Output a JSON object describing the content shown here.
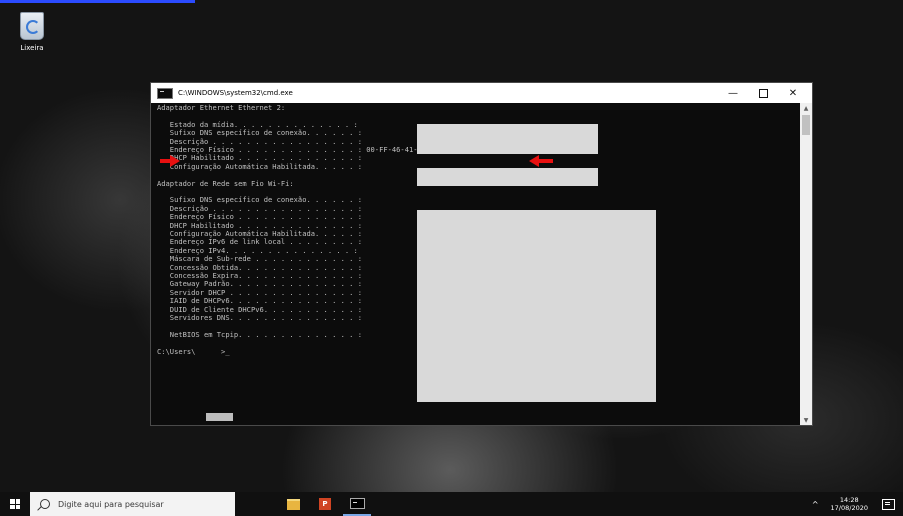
{
  "desktop": {
    "recycle_bin_label": "Lixeira"
  },
  "window": {
    "title": "C:\\WINDOWS\\system32\\cmd.exe",
    "minimize": "—",
    "close": "✕"
  },
  "console": {
    "lines": [
      "Adaptador Ethernet Ethernet 2:",
      "",
      "   Estado da mídia. . . . . . . . . . . . . . :",
      "   Sufixo DNS específico de conexão. . . . . . :",
      "   Descrição . . . . . . . . . . . . . . . . . :",
      "   Endereço Físico . . . . . . . . . . . . . . : 00-FF-46-41-8F-59",
      "   DHCP Habilitado . . . . . . . . . . . . . . :",
      "   Configuração Automática Habilitada. . . . . :",
      "",
      "Adaptador de Rede sem Fio Wi-Fi:",
      "",
      "   Sufixo DNS específico de conexão. . . . . . :",
      "   Descrição . . . . . . . . . . . . . . . . . :",
      "   Endereço Físico . . . . . . . . . . . . . . :",
      "   DHCP Habilitado . . . . . . . . . . . . . . :",
      "   Configuração Automática Habilitada. . . . . :",
      "   Endereço IPv6 de link local . . . . . . . . :",
      "   Endereço IPv4. . . . . . . . . . . . . . . :",
      "   Máscara de Sub-rede . . . . . . . . . . . . :",
      "   Concessão Obtida. . . . . . . . . . . . . . :",
      "   Concessão Expira. . . . . . . . . . . . . . :",
      "   Gateway Padrão. . . . . . . . . . . . . . . :",
      "   Servidor DHCP . . . . . . . . . . . . . . . :",
      "   IAID de DHCPv6. . . . . . . . . . . . . . . :",
      "   DUID de Cliente DHCPv6. . . . . . . . . . . :",
      "   Servidores DNS. . . . . . . . . . . . . . . :",
      "",
      "   NetBIOS em Tcpip. . . . . . . . . . . . . . :",
      "",
      "C:\\Users\\      >_"
    ]
  },
  "taskbar": {
    "search_placeholder": "Digite aqui para pesquisar",
    "ppt_letter": "P",
    "time": "14:28",
    "date": "17/08/2020",
    "tray_chevron": "^"
  },
  "colors": {
    "console_bg": "#0c0c0c",
    "console_text": "#c0c0c0",
    "redaction": "#d9d9d9",
    "annotation_arrow": "#e81010"
  }
}
